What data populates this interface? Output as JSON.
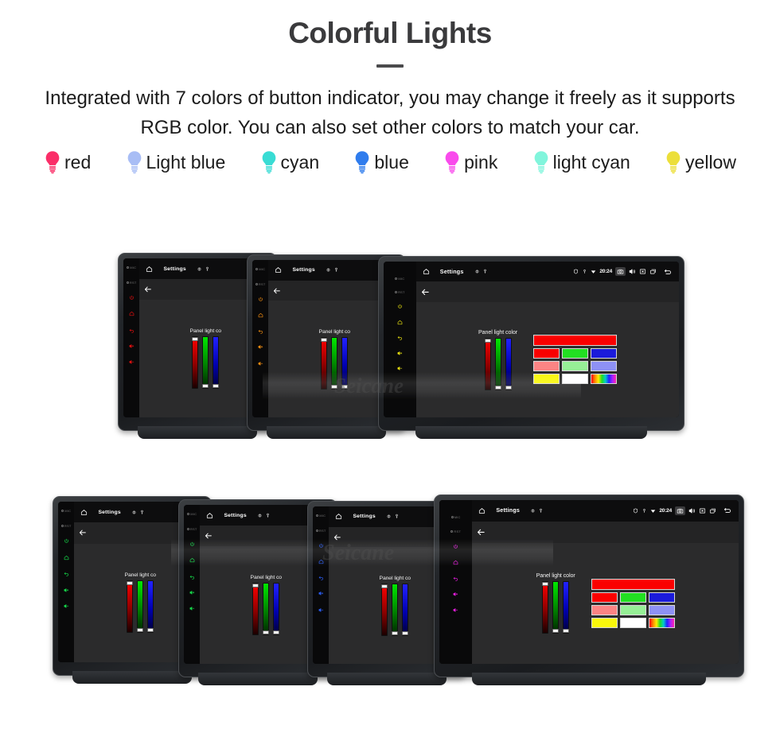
{
  "header": {
    "title": "Colorful Lights",
    "subtitle": "Integrated with 7 colors of button indicator, you may change it freely as it supports RGB color. You can also set other colors to match your car."
  },
  "bulbs": [
    {
      "label": "red",
      "color": "#fa2e68",
      "icon": "bulb-icon"
    },
    {
      "label": "Light blue",
      "color": "#a8bdf5",
      "icon": "bulb-icon"
    },
    {
      "label": "cyan",
      "color": "#39dcd4",
      "icon": "bulb-icon"
    },
    {
      "label": "blue",
      "color": "#2f7ced",
      "icon": "bulb-icon"
    },
    {
      "label": "pink",
      "color": "#f94bec",
      "icon": "bulb-icon"
    },
    {
      "label": "light cyan",
      "color": "#81f5dc",
      "icon": "bulb-icon"
    },
    {
      "label": "yellow",
      "color": "#ecdf3a",
      "icon": "bulb-icon"
    }
  ],
  "watermark": "Seicane",
  "device_ui": {
    "title": "Settings",
    "home_icon": "home-icon",
    "back_icon": "back-arrow-icon",
    "mini_icons": [
      "brightness-icon",
      "key-icon"
    ],
    "status": {
      "time": "20:24",
      "icons": [
        "shield-icon",
        "location-icon",
        "wifi-icon"
      ],
      "nav_icons": [
        "camera-icon",
        "volume-icon",
        "close-box-icon",
        "recent-apps-icon",
        "back-icon"
      ]
    },
    "panel_label": "Panel light color",
    "panel_label_short": "Panel light co",
    "sliders": [
      {
        "name": "red-slider",
        "value": 100,
        "thumb": "top"
      },
      {
        "name": "green-slider",
        "value": 0,
        "thumb": "bottom"
      },
      {
        "name": "blue-slider",
        "value": 0,
        "thumb": "bottom"
      }
    ],
    "preview_color": "#fa0000",
    "swatches": [
      [
        "#fa0000",
        "#22e022",
        "#1b1bdb"
      ],
      [
        "#fb8484",
        "#96ef96",
        "#8e91f5"
      ],
      [
        "#f9f70b",
        "#ffffff",
        "rainbow"
      ]
    ],
    "hardware_keys": [
      {
        "name": "mic-key",
        "label": "MIC"
      },
      {
        "name": "reset-key",
        "label": "RST"
      },
      {
        "name": "power-key",
        "icon": "power-icon"
      },
      {
        "name": "home-key",
        "icon": "home-icon"
      },
      {
        "name": "back-key",
        "icon": "back-arrow-icon"
      },
      {
        "name": "volume-up-key",
        "icon": "volume-up-icon"
      },
      {
        "name": "volume-down-key",
        "icon": "volume-down-icon"
      }
    ]
  },
  "devices_top_row": [
    {
      "name": "device-red",
      "key_color": "#e01010",
      "full": false
    },
    {
      "name": "device-orange",
      "key_color": "#ef8c10",
      "full": false
    },
    {
      "name": "device-yellow",
      "key_color": "#e8e010",
      "full": true
    }
  ],
  "devices_bottom_row": [
    {
      "name": "device-green-1",
      "key_color": "#16d94a",
      "full": false
    },
    {
      "name": "device-green-2",
      "key_color": "#16d94a",
      "full": false
    },
    {
      "name": "device-blue",
      "key_color": "#2b5ef5",
      "full": false
    },
    {
      "name": "device-magenta",
      "key_color": "#e81fe0",
      "full": true
    }
  ]
}
